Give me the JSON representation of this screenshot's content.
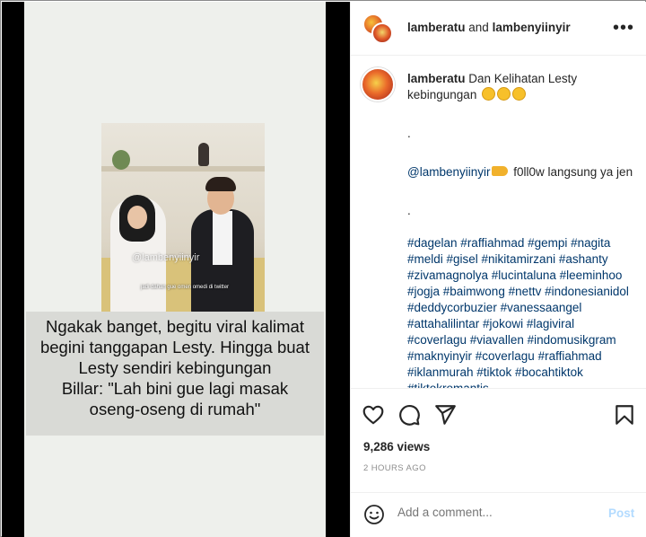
{
  "post": {
    "header_user1": "lamberatu",
    "header_and": " and ",
    "header_user2": "lambenyiinyir",
    "more_icon": "more-dots-icon"
  },
  "media": {
    "watermark": "@lambenyiinyir",
    "subtitle": "jadi dahan gue omen omedi di twitter",
    "caption_lines": [
      "Ngakak banget, begitu viral kalimat",
      "begini tanggapan Lesty. Hingga buat",
      "Lesty sendiri kebingungan",
      "Billar: \"Lah bini gue lagi masak",
      "oseng-oseng di rumah\""
    ]
  },
  "comment": {
    "username": "lamberatu",
    "text": " Dan Kelihatan Lesty kebingungan",
    "dot1": ".",
    "mention": "@lambenyiinyir",
    "follow_text": " f0ll0w langsung ya jen",
    "dot2": ".",
    "hashtags": "#dagelan #raffiahmad #gempi #nagita #meldi #gisel #nikitamirzani #ashanty #zivamagnolya #lucintaluna #leeminhoo #jogja #baimwong #nettv #indonesianidol #deddycorbuzier #vanessaangel #attahalilintar #jokowi #lagiviral #coverlagu #viavallen #indomusikgram #maknyinyir #coverlagu #raffiahmad #iklanmurah #tiktok #bocahtiktok #tiktokromantis"
  },
  "stats": {
    "views": "9,286 views",
    "time": "2 HOURS AGO"
  },
  "add_comment": {
    "placeholder": "Add a comment...",
    "post_label": "Post"
  },
  "colors": {
    "link": "#00376b",
    "muted": "#8e8e8e",
    "post_disabled": "#b3dbff"
  }
}
